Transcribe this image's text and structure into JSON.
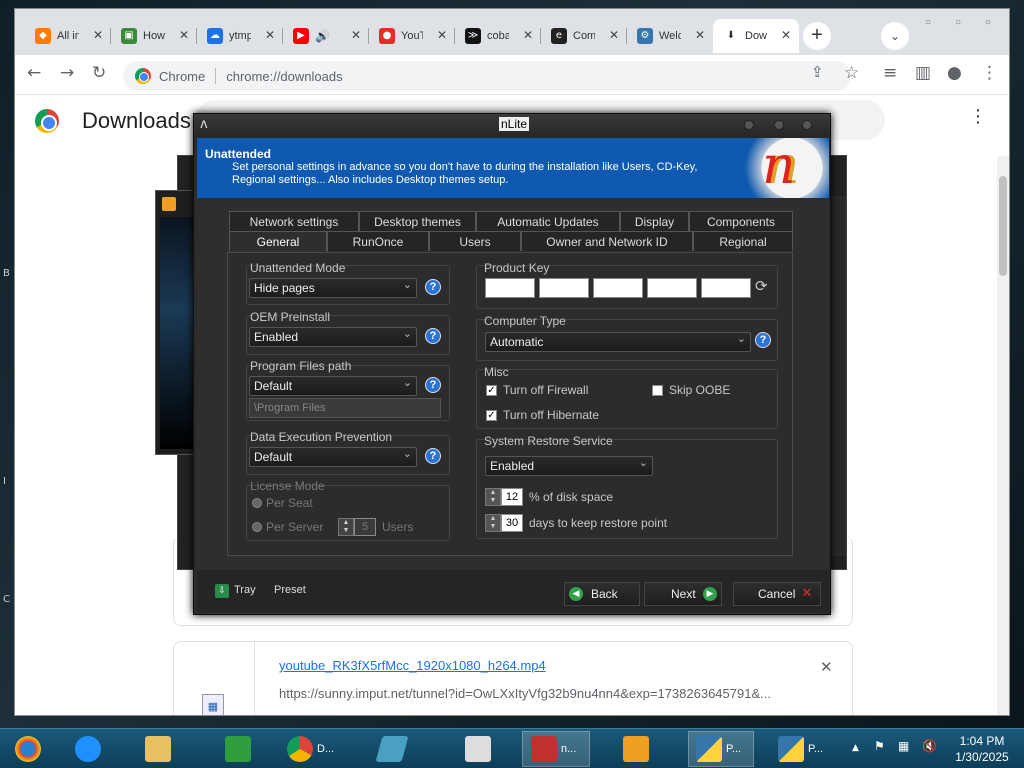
{
  "desktop": {
    "marks": [
      "B",
      "I",
      "C"
    ]
  },
  "chrome": {
    "tabs": [
      {
        "title": "All in",
        "color": "#ff7a00",
        "glyph": "◆"
      },
      {
        "title": "How",
        "color": "#3a8a3a",
        "glyph": "▣"
      },
      {
        "title": "ytmp",
        "color": "#1a73e8",
        "glyph": "☁"
      },
      {
        "title": "",
        "color": "#ff0000",
        "glyph": "▶",
        "audio": "🔊"
      },
      {
        "title": "YouT",
        "color": "#e52d27",
        "glyph": "●"
      },
      {
        "title": "coba",
        "color": "#111111",
        "glyph": "≫"
      },
      {
        "title": "Com",
        "color": "#222222",
        "glyph": "e"
      },
      {
        "title": "Welc",
        "color": "#3776ab",
        "glyph": "⚙"
      },
      {
        "title": "Dow",
        "color": "#555555",
        "glyph": "⬇"
      }
    ],
    "new_tab": "+",
    "tab_search": "⌄",
    "window_controls": [
      "○",
      "○",
      "○"
    ],
    "address": {
      "site_label": "Chrome",
      "url": "chrome://downloads"
    },
    "toolbar_icons": {
      "back": "←",
      "forward": "→",
      "reload": "↻",
      "share": "⇪",
      "star": "☆",
      "media": "≡",
      "sidepanel": "▥",
      "profile": "●",
      "menu": "⋮"
    }
  },
  "downloads": {
    "title": "Downloads",
    "menu": "⋮",
    "item": {
      "filename": "youtube_RK3fX5rfMcc_1920x1080_h264.mp4",
      "url": "https://sunny.imput.net/tunnel?id=OwLXxItyVfg32b9nu4nn4&exp=1738263645791&...",
      "remove": "✕"
    }
  },
  "nlite": {
    "title": "nLite",
    "header_title": "Unattended",
    "header_desc": "Set personal settings in advance so you don't have to during the installation like Users, CD-Key, Regional settings... Also includes Desktop themes setup.",
    "logo_glyph": "n",
    "tabs_row1": [
      "Network settings",
      "Desktop themes",
      "Automatic Updates",
      "Display",
      "Components"
    ],
    "tabs_row2": [
      "General",
      "RunOnce",
      "Users",
      "Owner and Network ID",
      "Regional"
    ],
    "unattended_mode": {
      "label": "Unattended Mode",
      "value": "Hide pages"
    },
    "oem_preinstall": {
      "label": "OEM Preinstall",
      "value": "Enabled"
    },
    "program_files": {
      "label": "Program Files path",
      "value": "Default",
      "path": "\\Program Files"
    },
    "dep": {
      "label": "Data Execution Prevention",
      "value": "Default"
    },
    "license_mode": {
      "label": "License Mode",
      "per_seat": "Per Seat",
      "per_server": "Per Server",
      "users": "5",
      "users_label": "Users"
    },
    "product_key": {
      "label": "Product Key"
    },
    "computer_type": {
      "label": "Computer Type",
      "value": "Automatic"
    },
    "misc": {
      "label": "Misc",
      "firewall": "Turn off Firewall",
      "hibernate": "Turn off Hibernate",
      "oobe": "Skip OOBE"
    },
    "system_restore": {
      "label": "System Restore Service",
      "value": "Enabled",
      "disk": "12",
      "disk_label": "% of disk space",
      "days": "30",
      "days_label": "days to keep restore point"
    },
    "help_glyph": "?",
    "footer": {
      "tray": "Tray",
      "preset": "Preset",
      "back": "Back",
      "next": "Next",
      "cancel": "Cancel"
    }
  },
  "taskbar": {
    "items": [
      {
        "label": "",
        "color": "#2a7fd0"
      },
      {
        "label": "",
        "color": "#1e90ff"
      },
      {
        "label": "",
        "color": "#e8c060"
      },
      {
        "label": "",
        "color": "#2e9e3e"
      },
      {
        "label": "D...",
        "color": "#db4437"
      },
      {
        "label": "",
        "color": "#4aa0c0"
      },
      {
        "label": "",
        "color": "#dddddd"
      },
      {
        "label": "n...",
        "color": "#c03030"
      },
      {
        "label": "",
        "color": "#f0a020"
      },
      {
        "label": "P...",
        "color": "#3776ab"
      },
      {
        "label": "P...",
        "color": "#3776ab"
      }
    ],
    "tray_icons": [
      "▲",
      "⚑",
      "▦",
      "🔇"
    ],
    "time": "1:04 PM",
    "date": "1/30/2025"
  }
}
